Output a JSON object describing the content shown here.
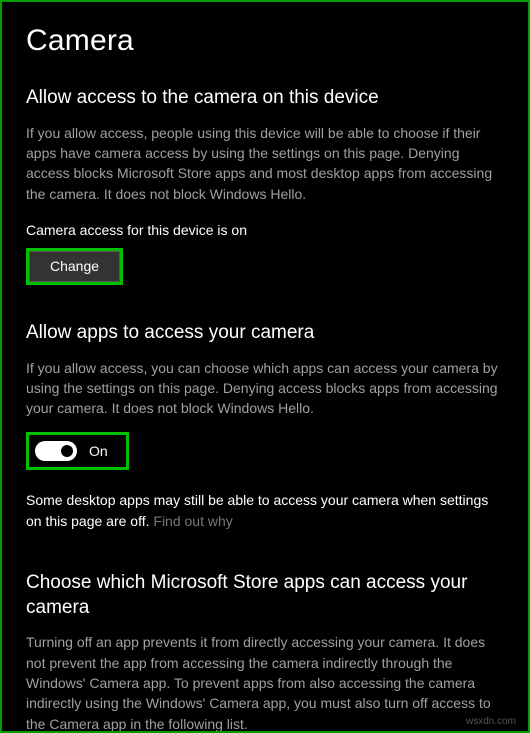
{
  "page": {
    "title": "Camera"
  },
  "section1": {
    "heading": "Allow access to the camera on this device",
    "description": "If you allow access, people using this device will be able to choose if their apps have camera access by using the settings on this page. Denying access blocks Microsoft Store apps and most desktop apps from accessing the camera. It does not block Windows Hello.",
    "status": "Camera access for this device is on",
    "button_label": "Change"
  },
  "section2": {
    "heading": "Allow apps to access your camera",
    "description": "If you allow access, you can choose which apps can access your camera by using the settings on this page. Denying access blocks apps from accessing your camera. It does not block Windows Hello.",
    "toggle_state": "On",
    "note_prefix": "Some desktop apps may still be able to access your camera when settings on this page are off. ",
    "note_link": "Find out why"
  },
  "section3": {
    "heading": "Choose which Microsoft Store apps can access your camera",
    "description": "Turning off an app prevents it from directly accessing your camera. It does not prevent the app from accessing the camera indirectly through the Windows' Camera app. To prevent apps from also accessing the camera indirectly using the Windows' Camera app, you must also turn off access to the Camera app in the following list."
  },
  "watermark": "wsxdn.com"
}
